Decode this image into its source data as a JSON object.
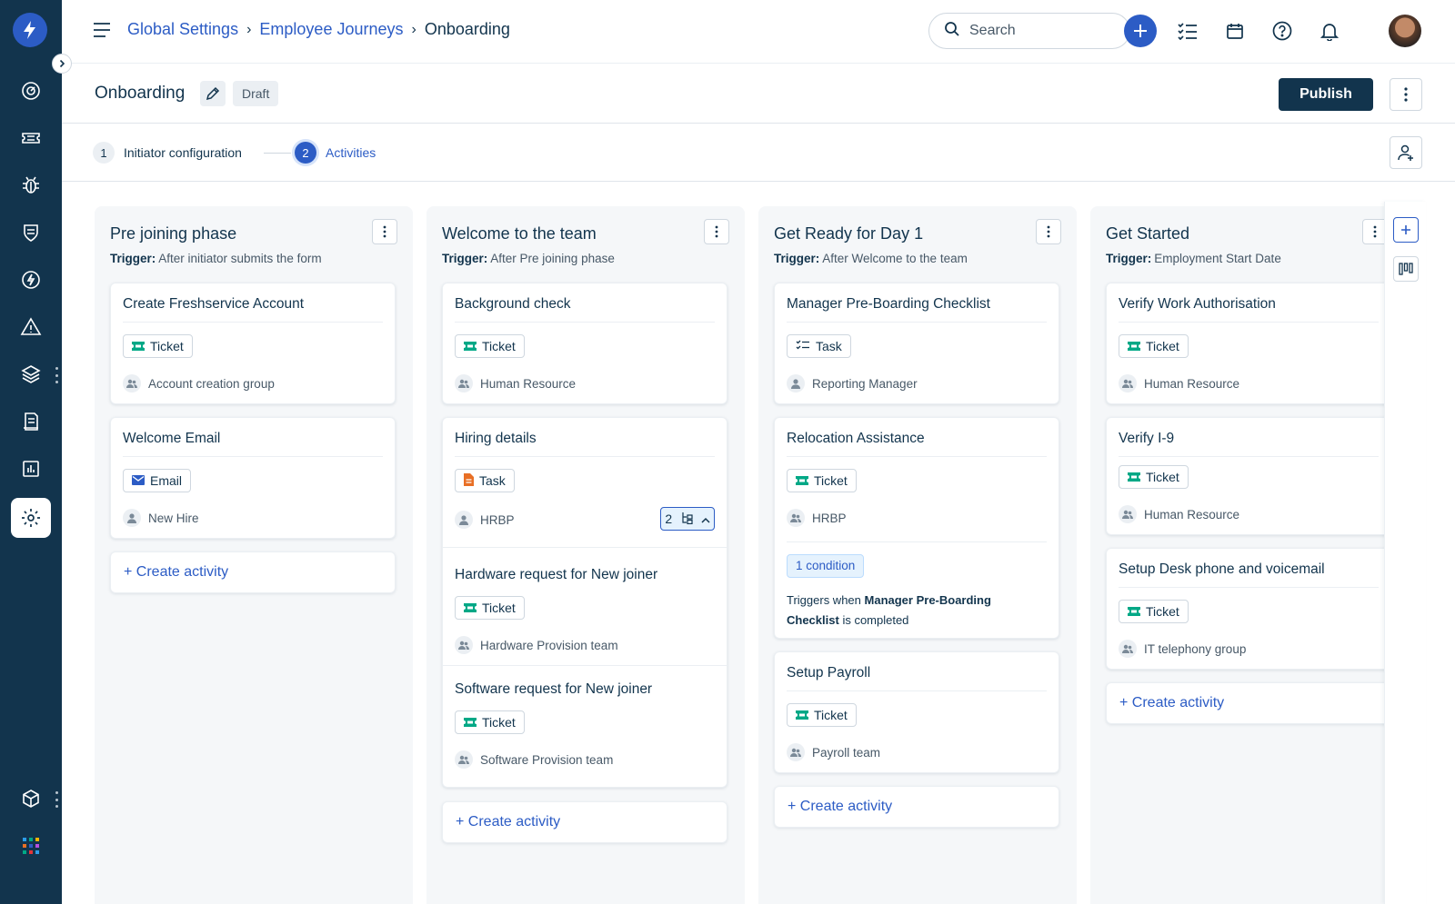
{
  "colors": {
    "sidebar": "#12344d",
    "accent": "#2c5cc5",
    "ticket": "#00a886",
    "email": "#2c5cc5",
    "task_doc": "#e86f25"
  },
  "topbar": {
    "breadcrumb": [
      "Global Settings",
      "Employee Journeys",
      "Onboarding"
    ],
    "search_placeholder": "Search"
  },
  "header": {
    "title": "Onboarding",
    "status": "Draft",
    "publish_label": "Publish"
  },
  "steps": [
    {
      "number": "1",
      "label": "Initiator configuration"
    },
    {
      "number": "2",
      "label": "Activities"
    }
  ],
  "trigger_label": "Trigger:",
  "create_label": "+ Create activity",
  "columns": [
    {
      "title": "Pre joining phase",
      "trigger": "After initiator submits the form",
      "cards": [
        {
          "title": "Create Freshservice Account",
          "type": "Ticket",
          "type_icon": "ticket-icon",
          "assignee": "Account creation group",
          "assignee_icon": "group-icon"
        },
        {
          "title": "Welcome Email",
          "type": "Email",
          "type_icon": "email-icon",
          "assignee": "New Hire",
          "assignee_icon": "person-icon"
        }
      ]
    },
    {
      "title": "Welcome to the team",
      "trigger": "After Pre joining phase",
      "cards": [
        {
          "title": "Background check",
          "type": "Ticket",
          "type_icon": "ticket-icon",
          "assignee": "Human Resource",
          "assignee_icon": "group-icon"
        },
        {
          "title": "Hiring details",
          "type": "Task",
          "type_icon": "document-icon",
          "assignee": "HRBP",
          "assignee_icon": "person-icon",
          "subtask_count": "2"
        },
        {
          "title": "Hardware request for New joiner",
          "type": "Ticket",
          "type_icon": "ticket-icon",
          "assignee": "Hardware Provision team",
          "assignee_icon": "group-icon"
        },
        {
          "title": "Software request for New joiner",
          "type": "Ticket",
          "type_icon": "ticket-icon",
          "assignee": "Software Provision team",
          "assignee_icon": "group-icon"
        }
      ]
    },
    {
      "title": "Get Ready for Day 1",
      "trigger": "After Welcome to the team",
      "cards": [
        {
          "title": "Manager Pre-Boarding Checklist",
          "type": "Task",
          "type_icon": "checklist-icon",
          "assignee": "Reporting Manager",
          "assignee_icon": "person-icon"
        },
        {
          "title": "Relocation Assistance",
          "type": "Ticket",
          "type_icon": "ticket-icon",
          "assignee": "HRBP",
          "assignee_icon": "group-icon",
          "condition": "1 condition",
          "condition_prefix": "Triggers when",
          "condition_target": "Manager Pre-Boarding Checklist",
          "condition_suffix": "is completed"
        },
        {
          "title": "Setup Payroll",
          "type": "Ticket",
          "type_icon": "ticket-icon",
          "assignee": "Payroll team",
          "assignee_icon": "group-icon"
        }
      ]
    },
    {
      "title": "Get Started",
      "trigger": "Employment Start Date",
      "cards": [
        {
          "title": "Verify Work Authorisation",
          "type": "Ticket",
          "type_icon": "ticket-icon",
          "assignee": "Human Resource",
          "assignee_icon": "group-icon"
        },
        {
          "title": "Verify I-9",
          "type": "Ticket",
          "type_icon": "ticket-icon",
          "assignee": "Human Resource",
          "assignee_icon": "group-icon"
        },
        {
          "title": "Setup Desk phone and voicemail",
          "type": "Ticket",
          "type_icon": "ticket-icon",
          "assignee": "IT telephony group",
          "assignee_icon": "group-icon"
        }
      ]
    }
  ]
}
